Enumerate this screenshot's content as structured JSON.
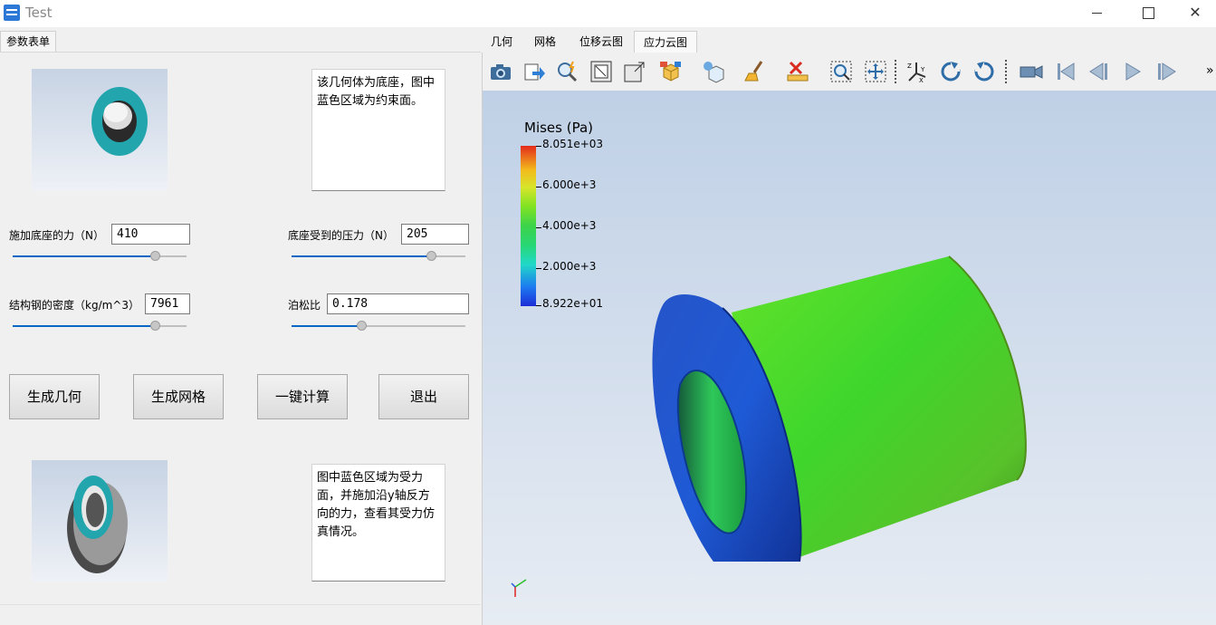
{
  "window": {
    "title": "Test"
  },
  "left": {
    "tab_label": "参数表单",
    "top_description": "该几何体为底座，图中蓝色区域为约束面。",
    "bottom_description": "图中蓝色区域为受力面，并施加沿y轴反方向的力，查看其受力仿真情况。",
    "params": {
      "force_label": "施加底座的力（N）",
      "force_value": "410",
      "force_slider": 0.82,
      "pressure_label": "底座受到的压力（N）",
      "pressure_value": "205",
      "pressure_slider": 0.8,
      "density_label": "结构钢的密度（kg/m^3）",
      "density_value": "7961",
      "density_slider": 0.82,
      "poisson_label": "泊松比",
      "poisson_value": "0.178",
      "poisson_slider": 0.4
    },
    "buttons": {
      "geometry": "生成几何",
      "mesh": "生成网格",
      "compute": "一键计算",
      "exit": "退出"
    }
  },
  "right": {
    "tabs": [
      "几何",
      "网格",
      "位移云图",
      "应力云图"
    ],
    "active_tab": "应力云图",
    "toolbar_icons": [
      "camera-icon",
      "export-icon",
      "highlight-icon",
      "fit-view-icon",
      "zoom-box-icon",
      "view-cube-icon",
      "lighting-icon",
      "clear-icon",
      "delete-icon",
      "zoom-region-icon",
      "pan-icon",
      "axes-icon",
      "rotate-cw-icon",
      "rotate-ccw-icon",
      "camera-record-icon",
      "first-frame-icon",
      "prev-frame-icon",
      "play-icon",
      "next-frame-icon"
    ],
    "more_label": "»",
    "legend": {
      "title": "Mises (Pa)",
      "ticks": [
        "8.051e+03",
        "6.000e+3",
        "4.000e+3",
        "2.000e+3",
        "8.922e+01"
      ],
      "max_color": "#e42b1c",
      "min_color": "#1b2bd7"
    }
  }
}
